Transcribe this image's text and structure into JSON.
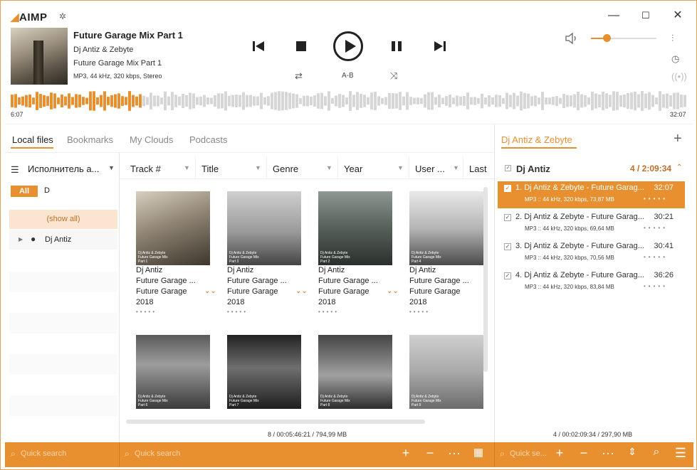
{
  "app": {
    "logo": "AIMP"
  },
  "colors": {
    "accent": "#e8902f",
    "accent_light": "#fbe5d0"
  },
  "now_playing": {
    "title": "Future Garage Mix Part 1",
    "artist": "Dj Antiz & Zebyte",
    "album": "Future Garage Mix Part 1",
    "format": "MP3, 44 kHz, 320 kbps, Stereo",
    "elapsed": "6:07",
    "total": "32:07",
    "progress": 0.19,
    "volume": 0.25
  },
  "controls": {
    "ab_label": "A-B"
  },
  "tabs": [
    "Local files",
    "Bookmarks",
    "My Clouds",
    "Podcasts"
  ],
  "left_panel": {
    "header": "Исполнитель а...",
    "filter_all": "All",
    "filter_letter": "D",
    "show_all": "(show all)",
    "artist": "Dj Antiz"
  },
  "columns": [
    "Track #",
    "Title",
    "Genre",
    "Year",
    "User ...",
    "Last"
  ],
  "albums": [
    {
      "artist": "Dj Antiz",
      "title": "Future Garage ...",
      "genre": "Future Garage",
      "year": "2018",
      "cover_text": "Dj Antiz & Zebyte\nFuture Garage Mix\nPart 1"
    },
    {
      "artist": "Dj Antiz",
      "title": "Future Garage ...",
      "genre": "Future Garage",
      "year": "2018",
      "cover_text": "Dj Antiz & Zebyte\nFuture Garage Mix\nPart 3"
    },
    {
      "artist": "Dj Antiz",
      "title": "Future Garage ...",
      "genre": "Future Garage",
      "year": "2018",
      "cover_text": "Dj Antiz & Zebyte\nFuture Garage Mix\nPart 2"
    },
    {
      "artist": "Dj Antiz",
      "title": "Future Garage ...",
      "genre": "Future Garage",
      "year": "2018",
      "cover_text": "Dj Antiz & Zebyte\nFuture Garage Mix\nPart 4"
    },
    {
      "cover_text": "Dj Antiz & Zebyte\nFuture Garage Mix\nPart 6"
    },
    {
      "cover_text": "Dj Antiz & Zebyte\nFuture Garage Mix\nPart 7"
    },
    {
      "cover_text": "Dj Antiz & Zebyte\nFuture Garage Mix\nPart 8"
    },
    {
      "cover_text": "Dj Antiz & Zebyte\nFuture Garage Mix\nPart 9"
    }
  ],
  "library_status": "8 / 00:05:46:21 / 794,99 MB",
  "playlist": {
    "tab": "Dj Antiz & Zebyte",
    "group": "Dj Antiz",
    "group_count": "4 / 2:09:34",
    "tracks": [
      {
        "title": "1. Dj Antiz & Zebyte - Future Garag...",
        "duration": "32:07",
        "info": "MP3 :: 44 kHz, 320 kbps, 73,87 MB"
      },
      {
        "title": "2. Dj Antiz & Zebyte - Future Garag...",
        "duration": "30:21",
        "info": "MP3 :: 44 kHz, 320 kbps, 69,64 MB"
      },
      {
        "title": "3. Dj Antiz & Zebyte - Future Garag...",
        "duration": "30:41",
        "info": "MP3 :: 44 kHz, 320 kbps, 70,56 MB"
      },
      {
        "title": "4. Dj Antiz & Zebyte - Future Garag...",
        "duration": "36:26",
        "info": "MP3 :: 44 kHz, 320 kbps, 83,84 MB"
      }
    ],
    "status": "4 / 00:02:09:34 / 297,90 MB"
  },
  "search": {
    "placeholder_left": "Quick search",
    "placeholder_mid": "Quick search",
    "placeholder_right": "Quick se..."
  }
}
